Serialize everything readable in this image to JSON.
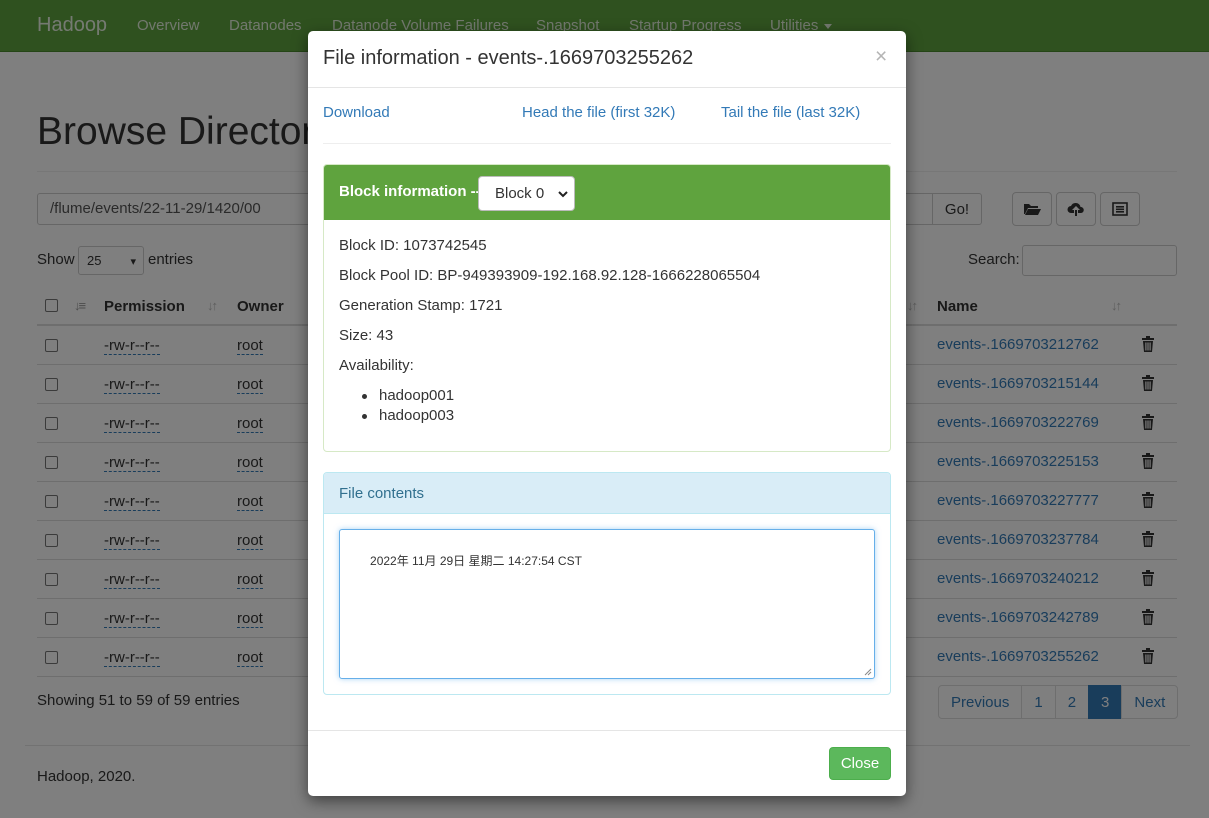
{
  "navbar": {
    "brand": "Hadoop",
    "items": [
      "Overview",
      "Datanodes",
      "Datanode Volume Failures",
      "Snapshot",
      "Startup Progress",
      "Utilities"
    ]
  },
  "page": {
    "title": "Browse Directory",
    "path_value": "/flume/events/22-11-29/1420/00",
    "go_label": "Go!",
    "show_label": "Show",
    "page_size": "25",
    "entries_label": "entries",
    "search_label": "Search:",
    "columns": [
      "Permission",
      "Owner",
      "Name"
    ],
    "rows": [
      {
        "permission": "-rw-r--r--",
        "owner": "root",
        "name": "events-.1669703212762"
      },
      {
        "permission": "-rw-r--r--",
        "owner": "root",
        "name": "events-.1669703215144"
      },
      {
        "permission": "-rw-r--r--",
        "owner": "root",
        "name": "events-.1669703222769"
      },
      {
        "permission": "-rw-r--r--",
        "owner": "root",
        "name": "events-.1669703225153"
      },
      {
        "permission": "-rw-r--r--",
        "owner": "root",
        "name": "events-.1669703227777"
      },
      {
        "permission": "-rw-r--r--",
        "owner": "root",
        "name": "events-.1669703237784"
      },
      {
        "permission": "-rw-r--r--",
        "owner": "root",
        "name": "events-.1669703240212"
      },
      {
        "permission": "-rw-r--r--",
        "owner": "root",
        "name": "events-.1669703242789"
      },
      {
        "permission": "-rw-r--r--",
        "owner": "root",
        "name": "events-.1669703255262"
      }
    ],
    "showing": "Showing 51 to 59 of 59 entries",
    "pagination": {
      "previous": "Previous",
      "pages": [
        "1",
        "2",
        "3"
      ],
      "active_page": "3",
      "next": "Next"
    },
    "footer": "Hadoop, 2020."
  },
  "modal": {
    "title": "File information - events-.1669703255262",
    "close_x": "×",
    "links": {
      "download": "Download",
      "head": "Head the file (first 32K)",
      "tail": "Tail the file (last 32K)"
    },
    "block_panel": {
      "title": "Block information --",
      "selected_block": "Block 0",
      "block_id": "Block ID: 1073742545",
      "block_pool_id": "Block Pool ID: BP-949393909-192.168.92.128-1666228065504",
      "generation_stamp": "Generation Stamp: 1721",
      "size": "Size: 43",
      "availability_label": "Availability:",
      "hosts": [
        "hadoop001",
        "hadoop003"
      ]
    },
    "contents_panel": {
      "title": "File contents",
      "text": "2022年 11月 29日 星期二 14:27:54 CST"
    },
    "close_label": "Close"
  },
  "colors": {
    "navbar_green": "#5fa33e",
    "link_blue": "#337ab7",
    "close_button_green": "#5cb85c",
    "info_panel_bg": "#d9edf7"
  }
}
